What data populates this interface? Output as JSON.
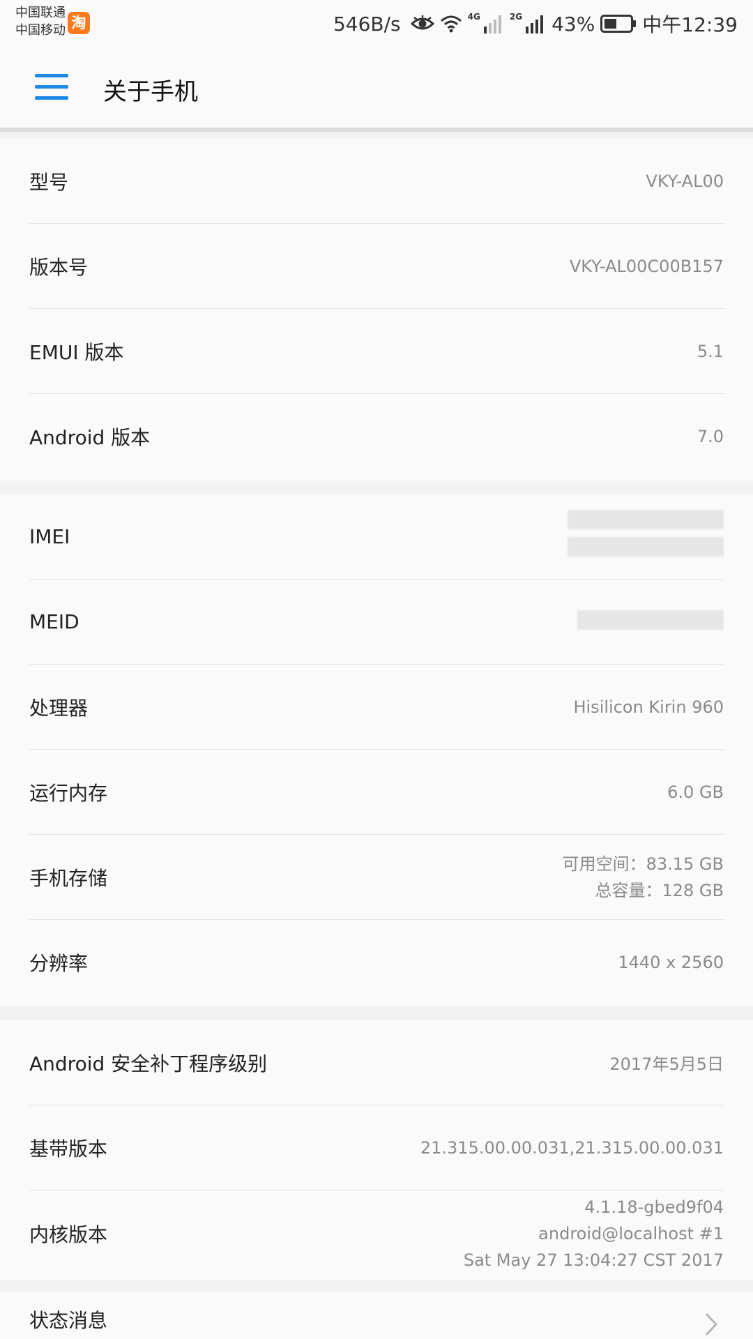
{
  "status_bar": {
    "carrier_1": "中国联通",
    "carrier_2": "中国移动",
    "app_badge": "淘",
    "net_speed": "546B/s",
    "net_tag_1": "4G",
    "net_tag_2": "2G",
    "battery": "43%",
    "time": "中午12:39"
  },
  "header": {
    "title": "关于手机",
    "menu_icon": "menu-icon"
  },
  "section_1": [
    {
      "label": "型号",
      "value": "VKY-AL00"
    },
    {
      "label": "版本号",
      "value": "VKY-AL00C00B157"
    },
    {
      "label": "EMUI 版本",
      "value": "5.1"
    },
    {
      "label": "Android 版本",
      "value": "7.0"
    }
  ],
  "section_2": {
    "imei_label": "IMEI",
    "meid_label": "MEID",
    "processor_label": "处理器",
    "processor_value": "Hisilicon Kirin 960",
    "ram_label": "运行内存",
    "ram_value": "6.0 GB",
    "storage_label": "手机存储",
    "storage_available": "可用空间：83.15  GB",
    "storage_total": "总容量：128  GB",
    "resolution_label": "分辨率",
    "resolution_value": "1440 x 2560"
  },
  "section_3": {
    "patch_label": "Android 安全补丁程序级别",
    "patch_value": "2017年5月5日",
    "baseband_label": "基带版本",
    "baseband_value": "21.315.00.00.031,21.315.00.00.031",
    "kernel_label": "内核版本",
    "kernel_line_1": "4.1.18-gbed9f04",
    "kernel_line_2": "android@localhost #1",
    "kernel_line_3": "Sat May 27 13:04:27 CST 2017"
  },
  "section_4": {
    "status_label": "状态消息"
  },
  "colors": {
    "accent": "#1e88e5",
    "background": "#f2f2f2",
    "card": "#fafafa"
  }
}
